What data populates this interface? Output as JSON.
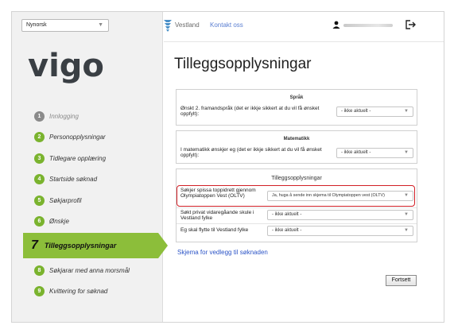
{
  "language_selector": {
    "value": "Nynorsk"
  },
  "logo": "vigo",
  "header": {
    "org_name": "Vestland",
    "contact_link": "Kontakt oss"
  },
  "steps": [
    {
      "num": "1",
      "label": "Innlogging",
      "state": "done"
    },
    {
      "num": "2",
      "label": "Personopplysningar",
      "state": "todo"
    },
    {
      "num": "3",
      "label": "Tidlegare opplæring",
      "state": "todo"
    },
    {
      "num": "4",
      "label": "Startside søknad",
      "state": "todo"
    },
    {
      "num": "5",
      "label": "Søkjarprofil",
      "state": "todo"
    },
    {
      "num": "6",
      "label": "Ønskje",
      "state": "todo"
    },
    {
      "num": "7",
      "label": "Tilleggsopplysningar",
      "state": "active"
    },
    {
      "num": "8",
      "label": "Søkjarar med anna morsmål",
      "state": "todo"
    },
    {
      "num": "9",
      "label": "Kvittering for søknad",
      "state": "todo"
    }
  ],
  "page_title": "Tilleggsopplysningar",
  "sections": {
    "sprak": {
      "title": "Språk",
      "question": "Ønskt 2. framandspråk (det er ikkje sikkert at du vil få ønsket oppfylt):",
      "value": "- ikke aktuelt -"
    },
    "matematikk": {
      "title": "Matematikk",
      "question": "I matematikk ønskjer eg (det er ikkje sikkert at du vil få ønsket oppfylt):",
      "value": "- ikke aktuelt -"
    },
    "tillegg": {
      "title": "Tilleggsopplysningar",
      "rows": [
        {
          "question": "Søkjer spissa toppidrett gjennom Olympiatoppen Vest (OLTV)",
          "value": "Ja, huga å sende inn skjema til Olympiatoppen vest (OLTV)"
        },
        {
          "question": "Søkt privat vidaregåande skule i Vestland fylke",
          "value": "- ikke aktuelt -"
        },
        {
          "question": "Eg skal flytte til Vestland fylke",
          "value": "- ikke aktuelt -"
        }
      ]
    }
  },
  "attachment_link": "Skjema for vedlegg til søknaden",
  "continue_button": "Fortsett",
  "colors": {
    "accent_green": "#8cbe3a",
    "step_green": "#7ab32e",
    "highlight_red": "#d21f26",
    "link_blue": "#2d55c7"
  }
}
